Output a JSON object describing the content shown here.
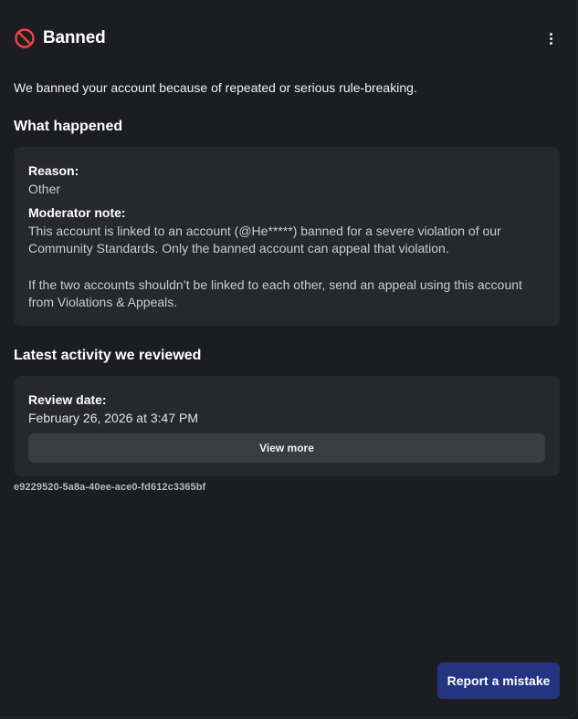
{
  "header": {
    "title": "Banned",
    "status_icon": "prohibited-icon",
    "status_color": "#ed4245",
    "menu_icon": "kebab-menu-icon"
  },
  "intro": "We banned your account because of repeated or serious rule-breaking.",
  "what_happened": {
    "title": "What happened",
    "reason_label": "Reason:",
    "reason_value": "Other",
    "note_label": "Moderator note:",
    "note_paragraph_1": "This account is linked to an account (@He*****) banned for a severe violation of our Community Standards. Only the banned account can appeal that violation.",
    "note_paragraph_2": "If the two accounts shouldn’t be linked to each other, send an appeal using this account from Violations & Appeals."
  },
  "activity": {
    "title": "Latest activity we reviewed",
    "review_date_label": "Review date:",
    "review_date_value": "February 26, 2026 at 3:47 PM",
    "view_more_label": "View more"
  },
  "case_id": "e9229520-5a8a-40ee-ace0-fd612c3365bf",
  "footer": {
    "report_label": "Report a mistake",
    "report_color": "#243481"
  }
}
